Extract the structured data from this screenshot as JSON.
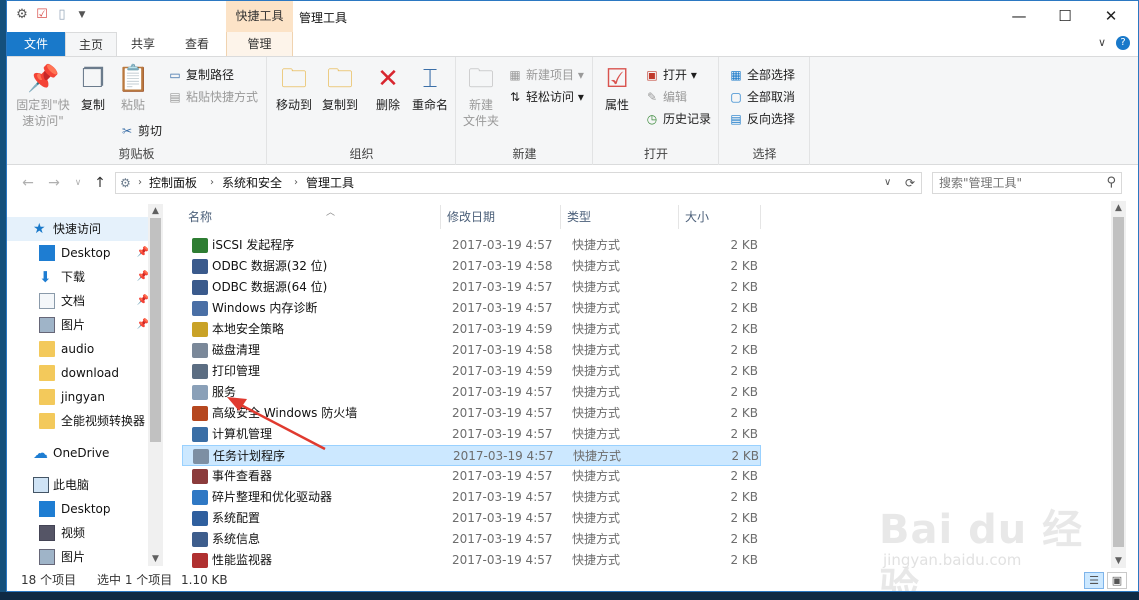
{
  "window": {
    "title": "管理工具",
    "context_tab_header": "快捷工具",
    "controls": {
      "minimize": "—",
      "maximize": "☐",
      "close": "✕"
    }
  },
  "tabs": {
    "file": "文件",
    "home": "主页",
    "share": "共享",
    "view": "查看",
    "manage": "管理",
    "expand_glyph": "∨",
    "help_glyph": "?"
  },
  "ribbon": {
    "clipboard": {
      "label": "剪贴板",
      "pin": "固定到\"快\n速访问\"",
      "copy": "复制",
      "paste": "粘贴",
      "copy_path": "复制路径",
      "paste_shortcut": "粘贴快捷方式",
      "cut": "剪切"
    },
    "organize": {
      "label": "组织",
      "move_to": "移动到",
      "copy_to": "复制到",
      "delete": "删除",
      "rename": "重命名"
    },
    "new": {
      "label": "新建",
      "new_folder": "新建\n文件夹",
      "new_item": "新建项目",
      "easy_access": "轻松访问"
    },
    "open": {
      "label": "打开",
      "properties": "属性",
      "open": "打开",
      "edit": "编辑",
      "history": "历史记录"
    },
    "select": {
      "label": "选择",
      "select_all": "全部选择",
      "select_none": "全部取消",
      "invert": "反向选择"
    }
  },
  "address": {
    "crumbs": [
      "控制面板",
      "系统和安全",
      "管理工具"
    ],
    "search_placeholder": "搜索\"管理工具\""
  },
  "nav": {
    "quick_access": "快速访问",
    "items": [
      {
        "label": "Desktop",
        "pinned": true
      },
      {
        "label": "下载",
        "pinned": true
      },
      {
        "label": "文档",
        "pinned": true
      },
      {
        "label": "图片",
        "pinned": true
      },
      {
        "label": "audio",
        "pinned": false
      },
      {
        "label": "download",
        "pinned": false
      },
      {
        "label": "jingyan",
        "pinned": false
      },
      {
        "label": "全能视频转换器",
        "pinned": false
      }
    ],
    "onedrive": "OneDrive",
    "this_pc": "此电脑",
    "pc_items": [
      "Desktop",
      "视频",
      "图片"
    ]
  },
  "columns": {
    "name": "名称",
    "date": "修改日期",
    "type": "类型",
    "size": "大小"
  },
  "files": [
    {
      "name": "iSCSI 发起程序",
      "date": "2017-03-19 4:57",
      "type": "快捷方式",
      "size": "2 KB",
      "icon": "iscsi-icon"
    },
    {
      "name": "ODBC 数据源(32 位)",
      "date": "2017-03-19 4:58",
      "type": "快捷方式",
      "size": "2 KB",
      "icon": "odbc-icon"
    },
    {
      "name": "ODBC 数据源(64 位)",
      "date": "2017-03-19 4:57",
      "type": "快捷方式",
      "size": "2 KB",
      "icon": "odbc-icon"
    },
    {
      "name": "Windows 内存诊断",
      "date": "2017-03-19 4:57",
      "type": "快捷方式",
      "size": "2 KB",
      "icon": "memory-diagnostic-icon"
    },
    {
      "name": "本地安全策略",
      "date": "2017-03-19 4:59",
      "type": "快捷方式",
      "size": "2 KB",
      "icon": "security-policy-icon"
    },
    {
      "name": "磁盘清理",
      "date": "2017-03-19 4:58",
      "type": "快捷方式",
      "size": "2 KB",
      "icon": "disk-cleanup-icon"
    },
    {
      "name": "打印管理",
      "date": "2017-03-19 4:59",
      "type": "快捷方式",
      "size": "2 KB",
      "icon": "print-management-icon"
    },
    {
      "name": "服务",
      "date": "2017-03-19 4:57",
      "type": "快捷方式",
      "size": "2 KB",
      "icon": "services-icon"
    },
    {
      "name": "高级安全 Windows 防火墙",
      "date": "2017-03-19 4:57",
      "type": "快捷方式",
      "size": "2 KB",
      "icon": "firewall-icon"
    },
    {
      "name": "计算机管理",
      "date": "2017-03-19 4:57",
      "type": "快捷方式",
      "size": "2 KB",
      "icon": "computer-management-icon"
    },
    {
      "name": "任务计划程序",
      "date": "2017-03-19 4:57",
      "type": "快捷方式",
      "size": "2 KB",
      "icon": "task-scheduler-icon",
      "selected": true
    },
    {
      "name": "事件查看器",
      "date": "2017-03-19 4:57",
      "type": "快捷方式",
      "size": "2 KB",
      "icon": "event-viewer-icon"
    },
    {
      "name": "碎片整理和优化驱动器",
      "date": "2017-03-19 4:57",
      "type": "快捷方式",
      "size": "2 KB",
      "icon": "defrag-icon"
    },
    {
      "name": "系统配置",
      "date": "2017-03-19 4:57",
      "type": "快捷方式",
      "size": "2 KB",
      "icon": "system-config-icon"
    },
    {
      "name": "系统信息",
      "date": "2017-03-19 4:57",
      "type": "快捷方式",
      "size": "2 KB",
      "icon": "system-info-icon"
    },
    {
      "name": "性能监视器",
      "date": "2017-03-19 4:57",
      "type": "快捷方式",
      "size": "2 KB",
      "icon": "performance-monitor-icon"
    }
  ],
  "status": {
    "count": "18 个项目",
    "selected": "选中 1 个项目",
    "size": "1.10 KB"
  },
  "watermark": {
    "logo": "Bai du 经验",
    "url": "jingyan.baidu.com"
  },
  "colors": {
    "accent": "#1979ca",
    "selection": "#cce8ff",
    "annotation_arrow": "#e03a2f"
  }
}
